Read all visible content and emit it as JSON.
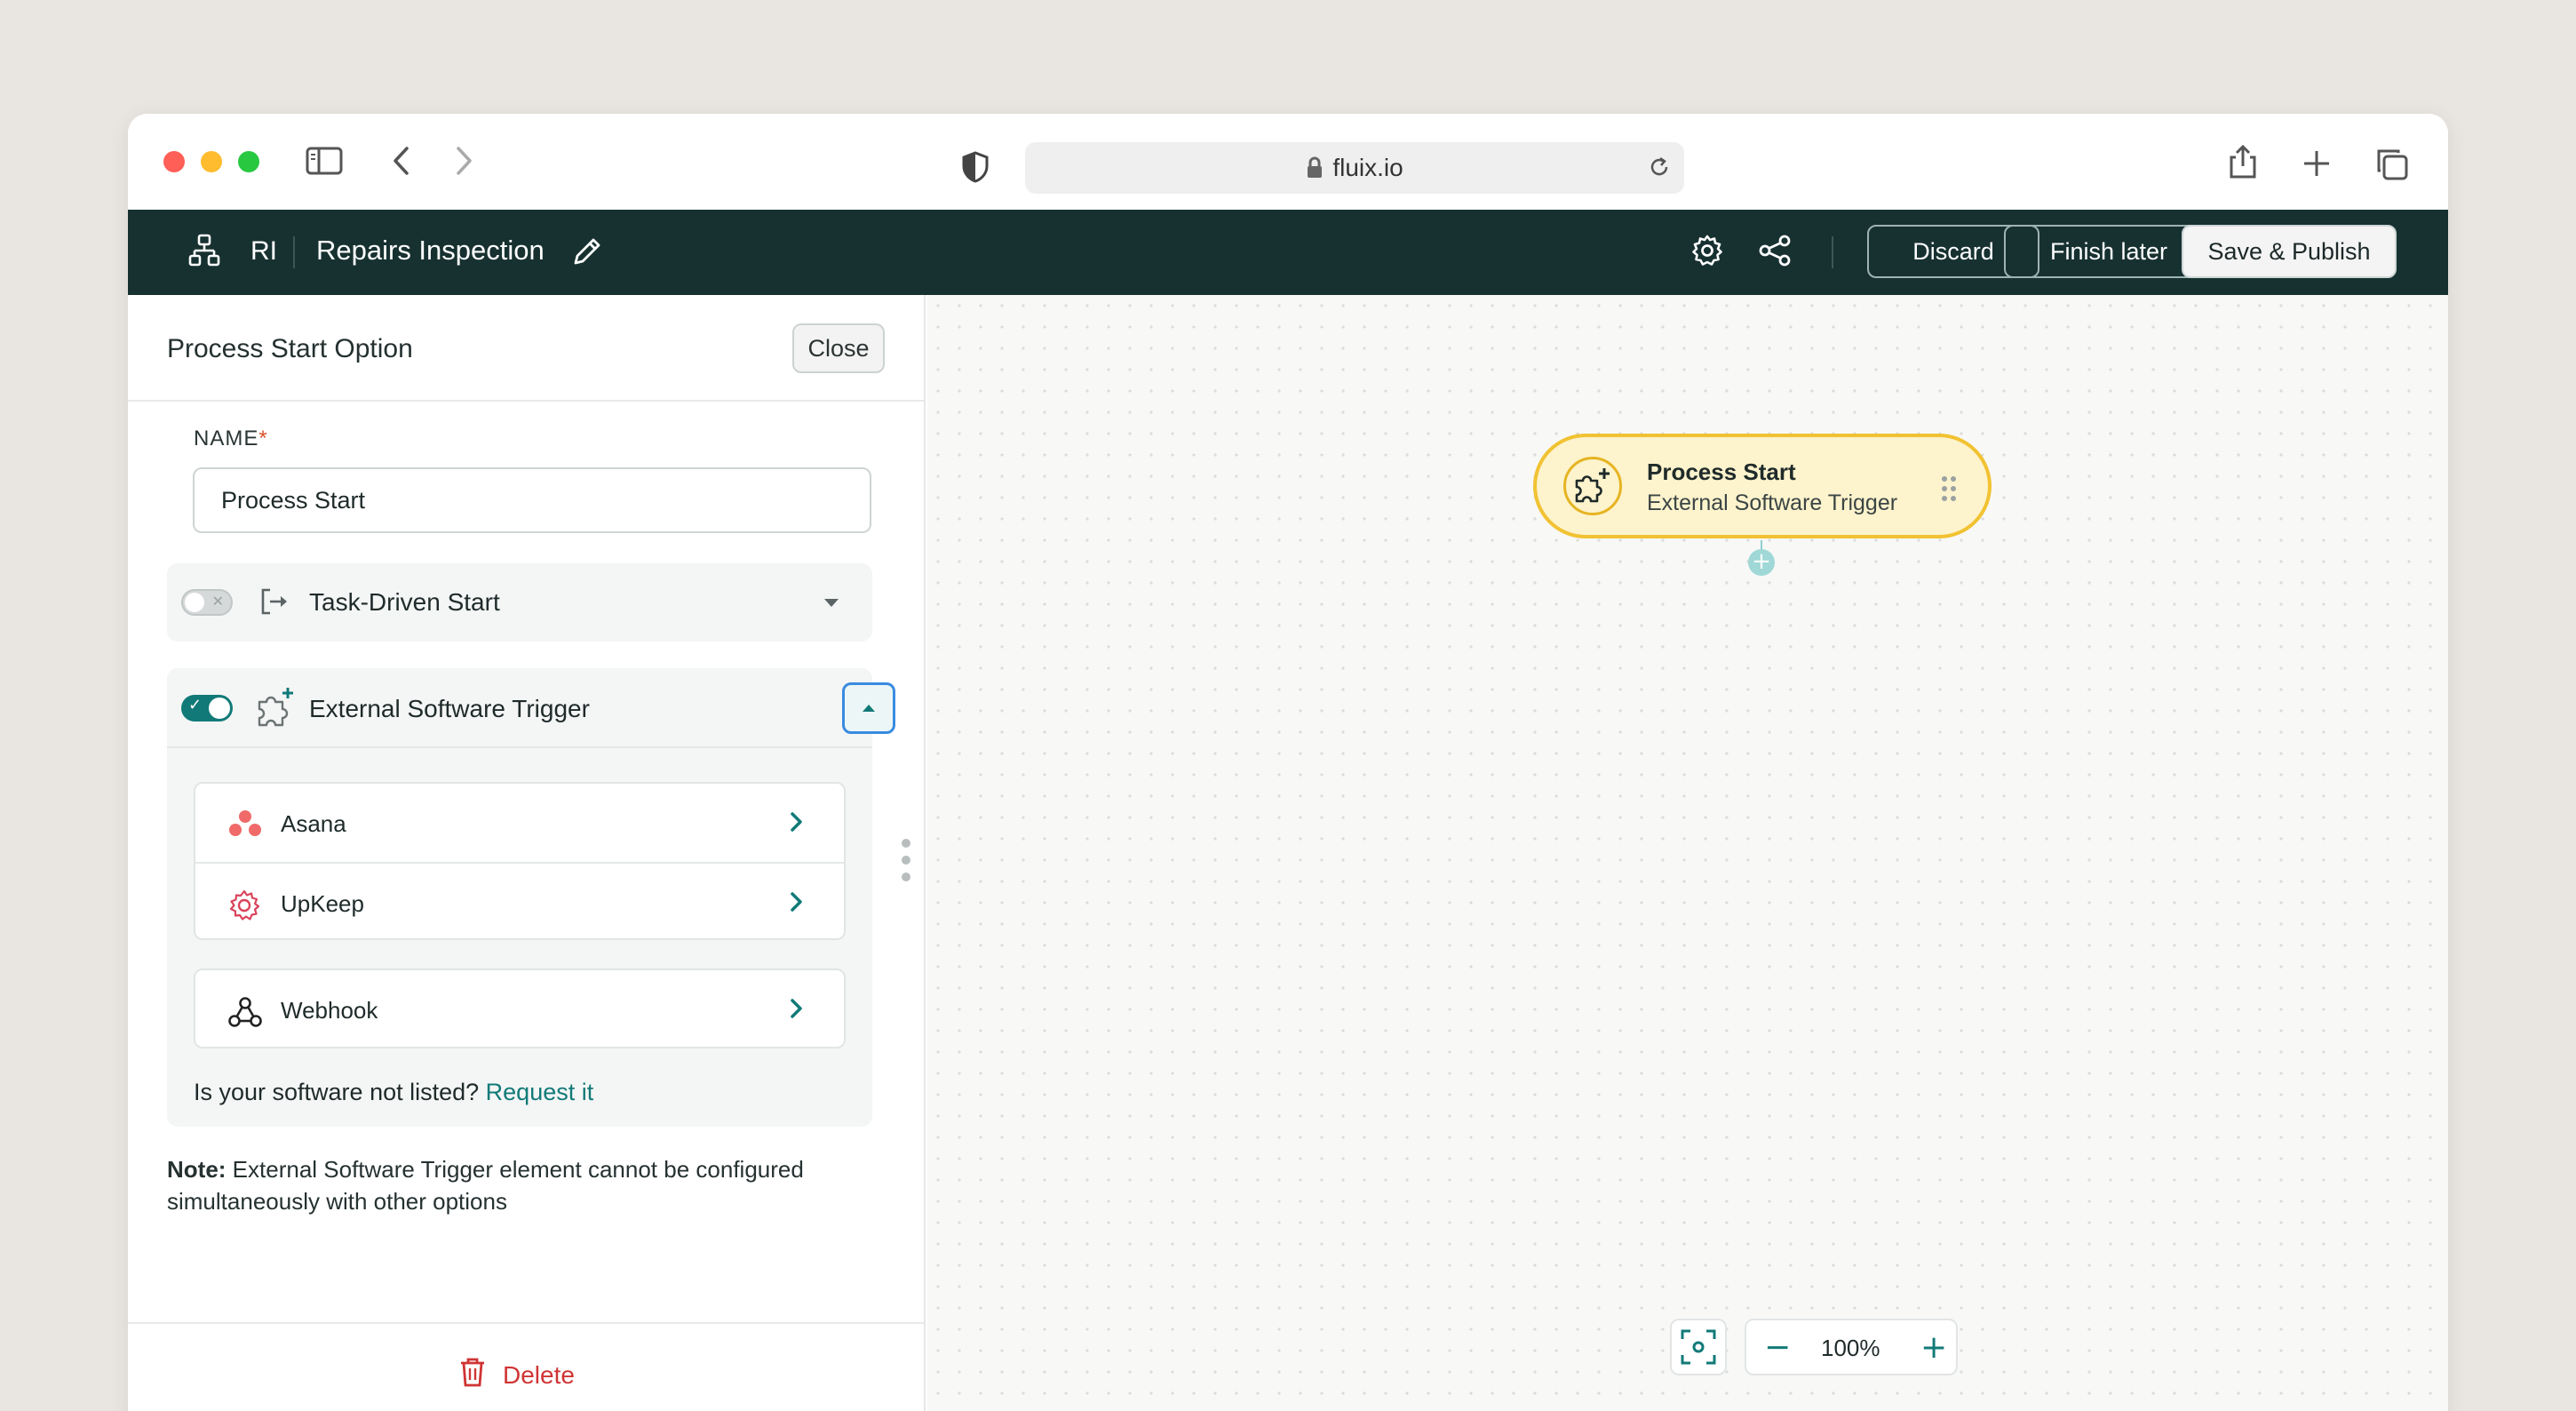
{
  "browser": {
    "url": "fluix.io"
  },
  "header": {
    "abbreviation": "RI",
    "title": "Repairs Inspection",
    "discard_label": "Discard",
    "finish_later_label": "Finish later",
    "publish_label": "Save & Publish"
  },
  "panel": {
    "title": "Process Start Option",
    "close_label": "Close",
    "name_label": "NAME",
    "name_required_mark": "*",
    "name_value": "Process Start",
    "task_driven": {
      "label": "Task-Driven Start",
      "enabled": false
    },
    "external_trigger": {
      "label": "External Software Trigger",
      "enabled": true,
      "apps": [
        {
          "label": "Asana",
          "icon": "asana-icon"
        },
        {
          "label": "UpKeep",
          "icon": "upkeep-icon"
        }
      ],
      "webhook": {
        "label": "Webhook",
        "icon": "webhook-icon"
      },
      "not_listed_text": "Is your software not listed?",
      "request_link": "Request it"
    },
    "note_bold": "Note:",
    "note_text": "External Software Trigger element cannot be configured simultaneously with other options",
    "delete_label": "Delete"
  },
  "canvas": {
    "node": {
      "title": "Process Start",
      "subtitle": "External Software Trigger"
    },
    "zoom": "100%"
  },
  "colors": {
    "header_bg": "#173131",
    "accent": "#117a78",
    "node_bg": "#fdf3cc",
    "node_border": "#f1c232",
    "danger": "#d03434"
  }
}
